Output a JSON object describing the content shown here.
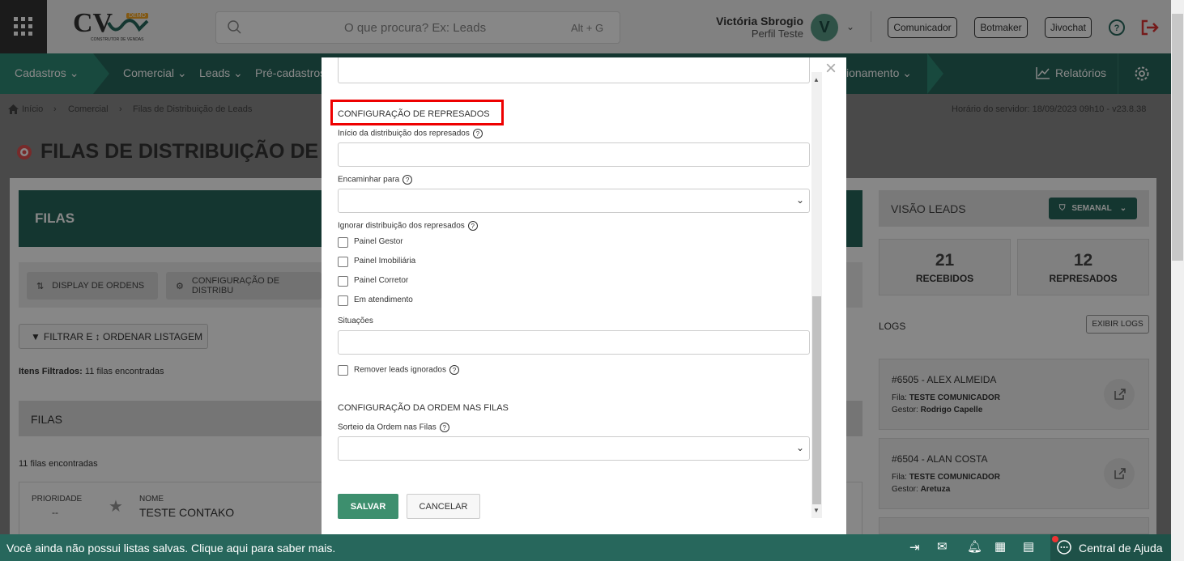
{
  "header": {
    "logo_text": "CV",
    "logo_sub": "CONSTRUTOR DE VENDAS",
    "logo_badge": "DEMO",
    "search_placeholder": "O que procura? Ex: Leads",
    "search_shortcut": "Alt + G",
    "user_name": "Victória Sbrogio",
    "user_profile": "Perfil Teste",
    "avatar_letter": "V",
    "buttons": [
      "Comunicador",
      "Botmaker",
      "Jivochat"
    ]
  },
  "nav": {
    "items": [
      "Cadastros",
      "Comercial",
      "Leads",
      "Pré-cadastros",
      "ionamento",
      "Relatórios"
    ]
  },
  "breadcrumb": {
    "items": [
      "Início",
      "Comercial",
      "Filas de Distribuição de Leads"
    ],
    "server_time": "Horário do servidor: 18/09/2023 09h10 - v23.8.38"
  },
  "page": {
    "title": "FILAS DE DISTRIBUIÇÃO DE L",
    "filas_header": "FILAS",
    "display_ordens": "DISPLAY DE ORDENS",
    "config_distrib": "CONFIGURAÇÃO DE DISTRIBU",
    "filter_label": "FILTRAR E ↕ ORDENAR LISTAGEM",
    "itens_filtrados_label": "Itens Filtrados:",
    "itens_filtrados_value": "11 filas encontradas",
    "filas_section": "FILAS",
    "filas_count": "11 filas encontradas",
    "card_priority_label": "PRIORIDADE",
    "card_priority_value": "--",
    "card_name_label": "NOME",
    "card_name_value": "TESTE CONTAKO"
  },
  "right_panel": {
    "title": "VISÃO LEADS",
    "period_button": "SEMANAL",
    "stats": [
      {
        "value": "21",
        "label": "RECEBIDOS"
      },
      {
        "value": "12",
        "label": "REPRESADOS"
      }
    ],
    "logs_title": "LOGS",
    "logs_button": "EXIBIR LOGS",
    "logs": [
      {
        "title": "#6505 - ALEX ALMEIDA",
        "fila_label": "Fila:",
        "fila": "TESTE COMUNICADOR",
        "gestor_label": "Gestor:",
        "gestor": "Rodrigo Capelle"
      },
      {
        "title": "#6504 - ALAN COSTA",
        "fila_label": "Fila:",
        "fila": "TESTE COMUNICADOR",
        "gestor_label": "Gestor:",
        "gestor": "Aretuza"
      }
    ]
  },
  "bottom_bar": {
    "message": "Você ainda não possui listas salvas. Clique aqui para saber mais.",
    "help": "Central de Ajuda"
  },
  "modal": {
    "section1_title": "CONFIGURAÇÃO DE REPRESADOS",
    "inicio_label": "Início da distribuição dos represados",
    "encaminhar_label": "Encaminhar para",
    "ignorar_label": "Ignorar distribuição dos represados",
    "checkboxes": [
      "Painel Gestor",
      "Painel Imobiliária",
      "Painel Corretor",
      "Em atendimento"
    ],
    "situacoes_label": "Situações",
    "remover_label": "Remover leads ignorados",
    "section2_title": "CONFIGURAÇÃO DA ORDEM NAS FILAS",
    "sorteio_label": "Sorteio da Ordem nas Filas",
    "save_button": "SALVAR",
    "cancel_button": "CANCELAR",
    "close_icon": "×"
  },
  "colors": {
    "primary": "#27675c",
    "accent": "#3d8f6e",
    "highlight": "#e00000"
  }
}
